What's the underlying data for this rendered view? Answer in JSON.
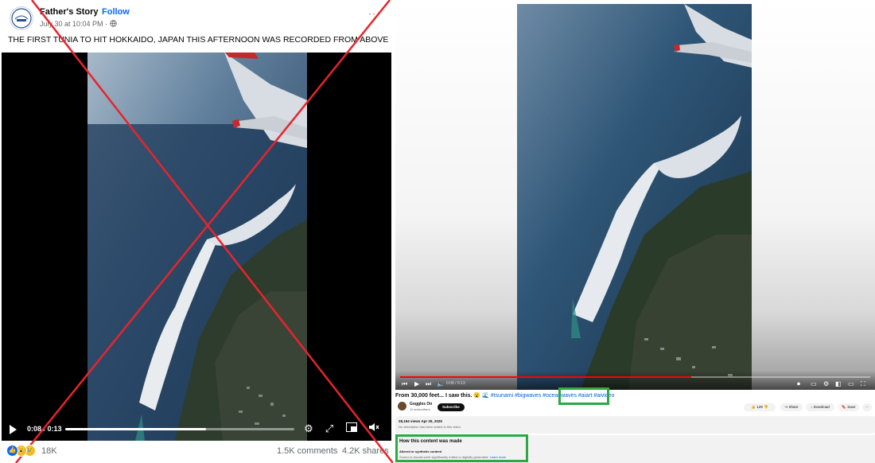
{
  "facebook": {
    "page_name": "Father's Story",
    "follow_label": "Follow",
    "separator": "·",
    "timestamp": "July 30 at 10:04 PM ·",
    "more_label": "···",
    "caption": "THE FIRST TUNIA TO HIT HOKKAIDO, JAPAN THIS AFTERNOON WAS RECORDED FROM ABOVE",
    "video": {
      "time": "0:08 / 0:13",
      "progress_fraction": 0.615
    },
    "reaction_count": "18K",
    "comments": "1.5K comments",
    "shares": "4.2K shares",
    "cross_color": "#e8242b"
  },
  "youtube": {
    "player_time": "0:08 / 0:13",
    "progress_fraction": 0.62,
    "title": "From 30,000 feet... I saw this. 😮 🌊",
    "hashtags": "#tsunami #bigwaves #oceanwaves",
    "ai_hashtags": "#aiart #aivideo",
    "channel": {
      "name": "Goggles On",
      "subscribers": "11 subscribers",
      "subscribe_label": "Subscribe"
    },
    "actions": {
      "likes": "129",
      "share": "Share",
      "download": "Download",
      "save": "Save",
      "more": "···"
    },
    "description": {
      "views_date": "28,194 views  Apr 29, 2025",
      "text": "No description has been added to this video."
    },
    "disclosure": {
      "title": "How this content was made",
      "subtitle": "Altered or synthetic content",
      "text": "Sound or visuals were significantly edited or digitally generated.",
      "learn_more": "Learn more"
    },
    "highlight_color": "#2ea844"
  }
}
